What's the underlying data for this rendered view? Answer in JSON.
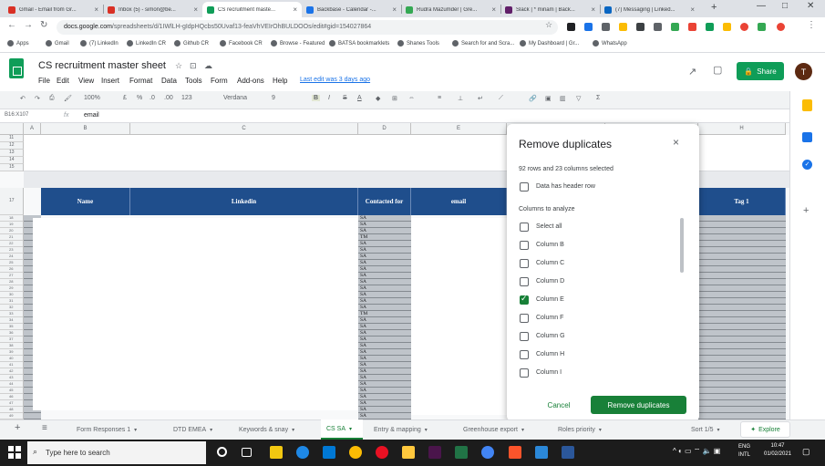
{
  "browser": {
    "tabs": [
      {
        "label": "Gmail - Email from Gr...",
        "color": "#d93025"
      },
      {
        "label": "Inbox (5) - simon@be...",
        "color": "#d93025"
      },
      {
        "label": "CS recruitment maste...",
        "color": "#0f9d58"
      },
      {
        "label": "Backbase - Calendar -...",
        "color": "#1a73e8"
      },
      {
        "label": "Rudra Mazumder | Gre...",
        "color": "#34a853"
      },
      {
        "label": "Slack | * miriam | Back...",
        "color": "#611f69"
      },
      {
        "label": "(7) Messaging | Linked...",
        "color": "#0a66c2"
      }
    ],
    "new_tab": "+",
    "url_host": "docs.google.com",
    "url_path": "/spreadsheets/d/1IWlLH-gIdpHQcbs50Uvaf13-feaVhVEIrOhBULDOOs/edit#gid=154027864",
    "bookmarks": [
      "Apps",
      "Gmail",
      "(7) LinkedIn",
      "LinkedIn CR",
      "Github CR",
      "Facebook CR",
      "Browse - Featured",
      "BATSA bookmarklets",
      "Shanes Tools",
      "Search for and Scra...",
      "My Dashboard | Gr...",
      "WhatsApp"
    ]
  },
  "doc": {
    "title": "CS recruitment master sheet",
    "menus": [
      "File",
      "Edit",
      "View",
      "Insert",
      "Format",
      "Data",
      "Tools",
      "Form",
      "Add-ons",
      "Help"
    ],
    "last_edit": "Last edit was 3 days ago",
    "share": "Share",
    "avatar": "T"
  },
  "toolbar": {
    "zoom": "100%",
    "currency": "£",
    "percent": "%",
    "dec1": ".0",
    "dec2": ".00",
    "format": "123",
    "font": "Verdana",
    "size": "9",
    "bold": "B",
    "italic": "I",
    "strike": "S",
    "textcolor": "A"
  },
  "formula": {
    "cellref": "B16:X107",
    "fx": "fx",
    "value": "email"
  },
  "grid": {
    "col_letters": [
      "A",
      "B",
      "C",
      "D",
      "E",
      "F",
      "G",
      "H"
    ],
    "row_numbers_top": [
      "11",
      "12",
      "13",
      "14",
      "15"
    ],
    "header_row_number": "17",
    "body_row_numbers": [
      "18",
      "19",
      "20",
      "21",
      "22",
      "23",
      "24",
      "25",
      "26",
      "27",
      "28",
      "29",
      "30",
      "31",
      "32",
      "33",
      "34",
      "35",
      "36",
      "37",
      "38",
      "39",
      "40",
      "41",
      "42",
      "43",
      "44",
      "45",
      "46",
      "47",
      "48",
      "49"
    ],
    "headers": {
      "name": "Name",
      "linkedin": "Linkedin",
      "contacted": "Contacted for",
      "email": "email",
      "tag": "Tag 1"
    },
    "contacted_values": [
      "SA",
      "SA",
      "SA",
      "TM",
      "SA",
      "SA",
      "SA",
      "SA",
      "SA",
      "SA",
      "SA",
      "SA",
      "SA",
      "SA",
      "SA",
      "TM",
      "SA",
      "SA",
      "SA",
      "SA",
      "SA",
      "SA",
      "SA",
      "SA",
      "SA",
      "SA",
      "SA",
      "SA",
      "SA",
      "SA",
      "SA",
      "SA"
    ]
  },
  "dialog": {
    "title": "Remove duplicates",
    "close": "×",
    "selection": "92 rows and 23 columns selected",
    "header_row_label": "Data has header row",
    "columns_to_analyze": "Columns to analyze",
    "options": [
      {
        "label": "Select all",
        "checked": false
      },
      {
        "label": "Column B",
        "checked": false
      },
      {
        "label": "Column C",
        "checked": false
      },
      {
        "label": "Column D",
        "checked": false
      },
      {
        "label": "Column E",
        "checked": true
      },
      {
        "label": "Column F",
        "checked": false
      },
      {
        "label": "Column G",
        "checked": false
      },
      {
        "label": "Column H",
        "checked": false
      },
      {
        "label": "Column I",
        "checked": false
      }
    ],
    "cancel": "Cancel",
    "remove": "Remove duplicates"
  },
  "sheets": {
    "add": "+",
    "all": "≡",
    "tabs": [
      "Form Responses 1",
      "DTD EMEA",
      "Keywords & snay",
      "CS SA",
      "Entry & mapping",
      "Greenhouse export",
      "Roles priority",
      "Sort 1/5"
    ],
    "active": "CS SA",
    "explore": "Explore"
  },
  "taskbar": {
    "search_placeholder": "Type here to search",
    "lang1": "ENG",
    "lang2": "INTL",
    "time": "10:47",
    "date": "01/02/2021"
  }
}
